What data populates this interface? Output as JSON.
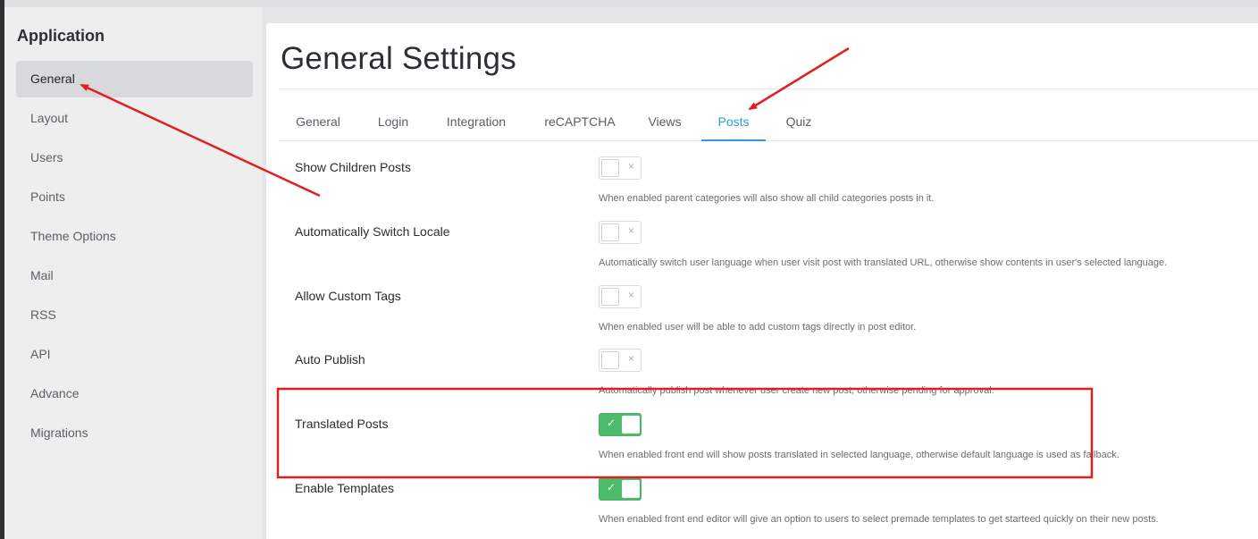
{
  "sidebar": {
    "title": "Application",
    "items": [
      {
        "label": "General",
        "active": true
      },
      {
        "label": "Layout"
      },
      {
        "label": "Users"
      },
      {
        "label": "Points"
      },
      {
        "label": "Theme Options"
      },
      {
        "label": "Mail"
      },
      {
        "label": "RSS"
      },
      {
        "label": "API"
      },
      {
        "label": "Advance"
      },
      {
        "label": "Migrations"
      }
    ]
  },
  "main": {
    "title": "General Settings",
    "tabs": [
      {
        "label": "General"
      },
      {
        "label": "Login"
      },
      {
        "label": "Integration"
      },
      {
        "label": "reCAPTCHA"
      },
      {
        "label": "Views"
      },
      {
        "label": "Posts",
        "active": true
      },
      {
        "label": "Quiz"
      }
    ],
    "settings": [
      {
        "label": "Show Children Posts",
        "enabled": false,
        "description": "When enabled parent categories will also show all child categories posts in it."
      },
      {
        "label": "Automatically Switch Locale",
        "enabled": false,
        "description": "Automatically switch user language when user visit post with translated URL, otherwise show contents in user's selected language."
      },
      {
        "label": "Allow Custom Tags",
        "enabled": false,
        "description": "When enabled user will be able to add custom tags directly in post editor."
      },
      {
        "label": "Auto Publish",
        "enabled": false,
        "description": "Automatically publish post whenever user create new post, otherwise pending for approval."
      },
      {
        "label": "Translated Posts",
        "enabled": true,
        "description": "When enabled front end will show posts translated in selected language, otherwise default language is used as fallback."
      },
      {
        "label": "Enable Templates",
        "enabled": true,
        "description": "When enabled front end editor will give an option to users to select premade templates to get starteed quickly on their new posts."
      }
    ]
  },
  "toggle_icons": {
    "off": "×",
    "on": "✓"
  },
  "colors": {
    "accent": "#2d9cdb",
    "toggle_on": "#4cbb6c",
    "annotation": "#e02020"
  }
}
